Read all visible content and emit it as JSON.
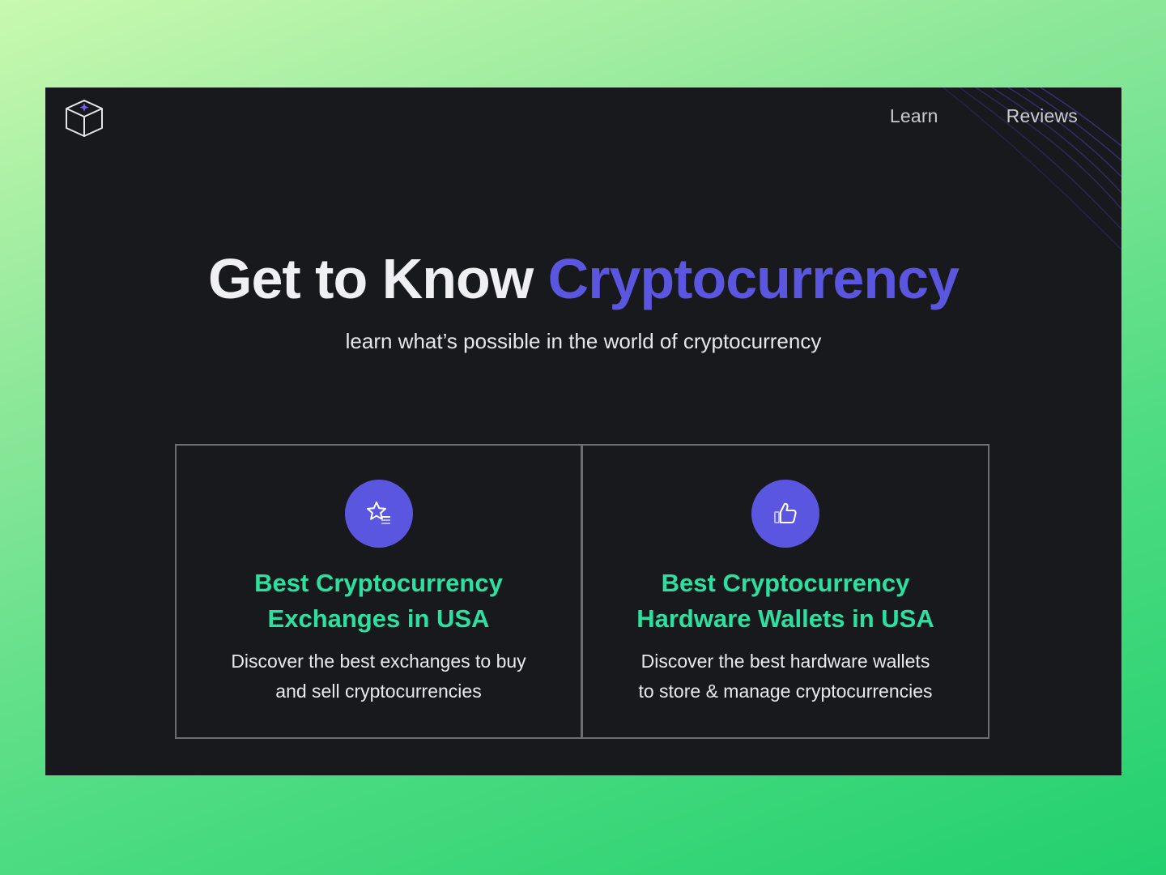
{
  "nav": {
    "items": [
      {
        "label": "Learn"
      },
      {
        "label": "Reviews"
      }
    ]
  },
  "hero": {
    "title_main": "Get to Know ",
    "title_accent": "Cryptocurrency",
    "subtitle": "learn what’s possible in the world of cryptocurrency"
  },
  "cards": [
    {
      "icon": "star-list-icon",
      "title_line1": "Best Cryptocurrency",
      "title_line2": "Exchanges in USA",
      "desc_line1": "Discover the best exchanges to buy",
      "desc_line2": "and sell cryptocurrencies"
    },
    {
      "icon": "thumbs-up-icon",
      "title_line1": "Best Cryptocurrency",
      "title_line2": "Hardware Wallets in USA",
      "desc_line1": "Discover the best hardware wallets",
      "desc_line2": "to store & manage cryptocurrencies"
    }
  ],
  "colors": {
    "accent": "#5b56e0",
    "card_title": "#2ee0a0",
    "panel_bg": "#18191c",
    "page_bg_start": "#c8f9b0",
    "page_bg_end": "#22d06e"
  }
}
